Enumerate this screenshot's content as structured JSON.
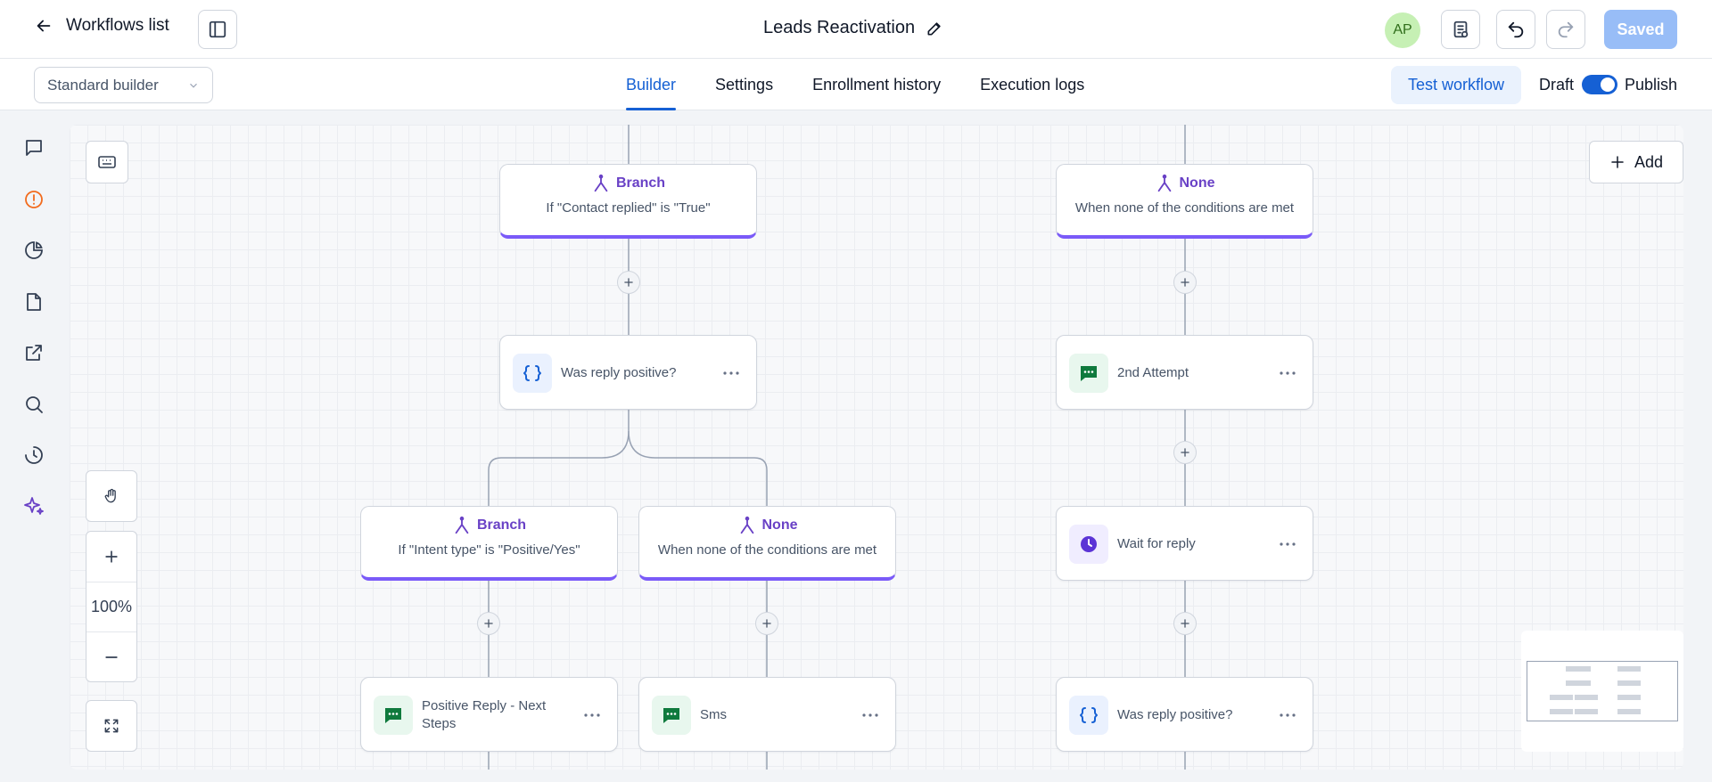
{
  "header": {
    "back_label": "Workflows list",
    "workflow_title": "Leads Reactivation",
    "avatar_initials": "AP",
    "saved_label": "Saved"
  },
  "subbar": {
    "builder_select": "Standard builder",
    "tabs": [
      {
        "label": "Builder",
        "active": true
      },
      {
        "label": "Settings",
        "active": false
      },
      {
        "label": "Enrollment history",
        "active": false
      },
      {
        "label": "Execution logs",
        "active": false
      }
    ],
    "test_label": "Test workflow",
    "draft_label": "Draft",
    "publish_label": "Publish",
    "published": true
  },
  "rail": {
    "icons": [
      "chat-icon",
      "alert-circle-icon",
      "pie-chart-icon",
      "file-icon",
      "external-link-icon",
      "search-icon",
      "history-icon",
      "sparkles-icon"
    ]
  },
  "canvas": {
    "add_label": "Add",
    "zoom_level": "100%",
    "nodes": {
      "branch_contact_replied": {
        "type": "Branch",
        "condition": "If \"Contact replied\" is \"True\""
      },
      "none_top": {
        "type": "None",
        "condition": "When none of the conditions are met"
      },
      "was_reply_positive_1": {
        "label": "Was reply positive?"
      },
      "second_attempt": {
        "label": "2nd Attempt"
      },
      "branch_intent": {
        "type": "Branch",
        "condition": "If \"Intent type\" is \"Positive/Yes\""
      },
      "none_mid": {
        "type": "None",
        "condition": "When none of the conditions are met"
      },
      "wait_for_reply": {
        "label": "Wait for reply"
      },
      "positive_reply": {
        "label": "Positive Reply - Next Steps"
      },
      "sms": {
        "label": "Sms"
      },
      "was_reply_positive_2": {
        "label": "Was reply positive?"
      }
    }
  },
  "colors": {
    "accent": "#1560d4",
    "branch": "#7a5af8",
    "sms_green": "#0f7a3d",
    "saved_bg": "#98bdf7"
  }
}
